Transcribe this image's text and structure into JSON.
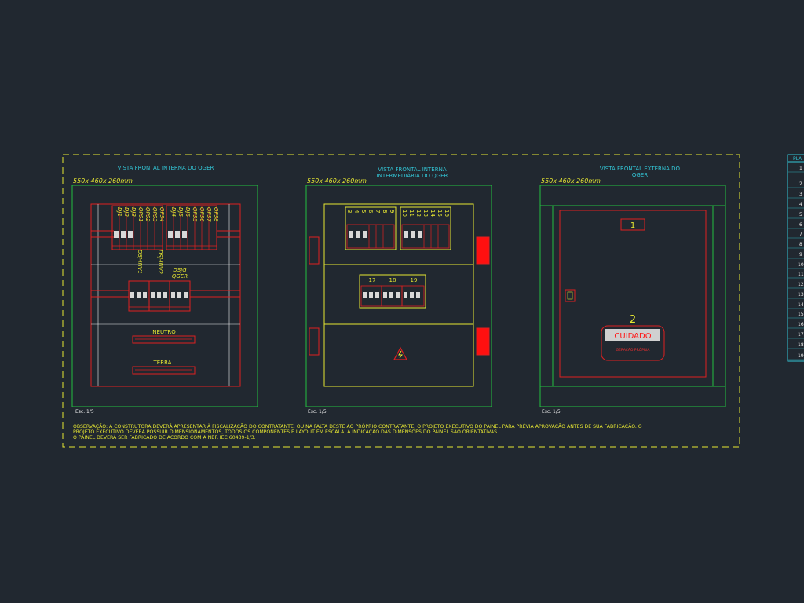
{
  "views": {
    "view1": {
      "title": "VISTA FRONTAL INTERNA DO QGER",
      "dims": "550x 460x 260mm",
      "scale": "Esc. 1/5"
    },
    "view2": {
      "title_line1": "VISTA FRONTAL INTERNA",
      "title_line2": "INTERMEDIÁRIA DO QGER",
      "dims": "550x 460x 260mm",
      "scale": "Esc. 1/5"
    },
    "view3": {
      "title_line1": "VISTA FRONTAL EXTERNA DO",
      "title_line2": "QGER",
      "dims": "550x 460x 260mm",
      "scale": "Esc. 1/5"
    }
  },
  "view1_labels": {
    "top_left": [
      "DJ1",
      "DJ2",
      "DJ3",
      "QPS1",
      "QPS2",
      "QPS3",
      "QPS4"
    ],
    "top_right": [
      "DJ4",
      "DJ5",
      "DJ6",
      "QPS5",
      "QPS6",
      "QPS7",
      "QPS8"
    ],
    "inv1": "DSJ-INV1",
    "inv2": "DSJ-INV2",
    "dsjg_line1": "DSJG",
    "dsjg_line2": "QGER",
    "neutro": "NEUTRO",
    "terra": "TERRA"
  },
  "view2_labels": {
    "top_left_nums": [
      "3",
      "4",
      "5",
      "6",
      "7",
      "8",
      "9"
    ],
    "top_right_nums": [
      "10",
      "11",
      "12",
      "13",
      "14",
      "15",
      "16"
    ],
    "mid_nums": [
      "17",
      "18",
      "19"
    ]
  },
  "view3_labels": {
    "label1": "1",
    "label2": "2",
    "warning": "CUIDADO",
    "warning_sub": "GERAÇÃO PRÓPRIA"
  },
  "observation": {
    "line1": "OBSERVAÇÃO: A CONSTRUTORA DEVERÁ APRESENTAR À FISCALIZAÇÃO DO CONTRATANTE, OU NA FALTA DESTE AO PRÓPRIO CONTRATANTE, O PROJETO EXECUTIVO DO PAINEL PARA PRÉVIA APROVAÇÃO ANTES DE SUA FABRICAÇÃO. O",
    "line2": "PROJETO EXECUTIVO DEVERÁ POSSUIR DIMENSIONAMENTOS, TODOS OS COMPONENTES E LAYOUT EM ESCALA. A INDICAÇÃO DAS DIMENSÕES DO PAINEL SÃO ORIENTATIVAS.",
    "line3": "O PAINEL DEVERÁ SER FABRICADO DE ACORDO COM A NBR IEC 60439-1/3."
  },
  "side_table": {
    "header": "PLA",
    "rows": [
      "1",
      "2",
      "3",
      "4",
      "5",
      "6",
      "7",
      "8",
      "9",
      "10",
      "11",
      "12",
      "13",
      "14",
      "15",
      "16",
      "17",
      "18",
      "19"
    ]
  },
  "colors": {
    "background": "#212830",
    "green": "#22c040",
    "red": "#e02020",
    "yellow": "#e8e832",
    "cyan": "#33c6d6",
    "white": "#f0f0f0"
  }
}
